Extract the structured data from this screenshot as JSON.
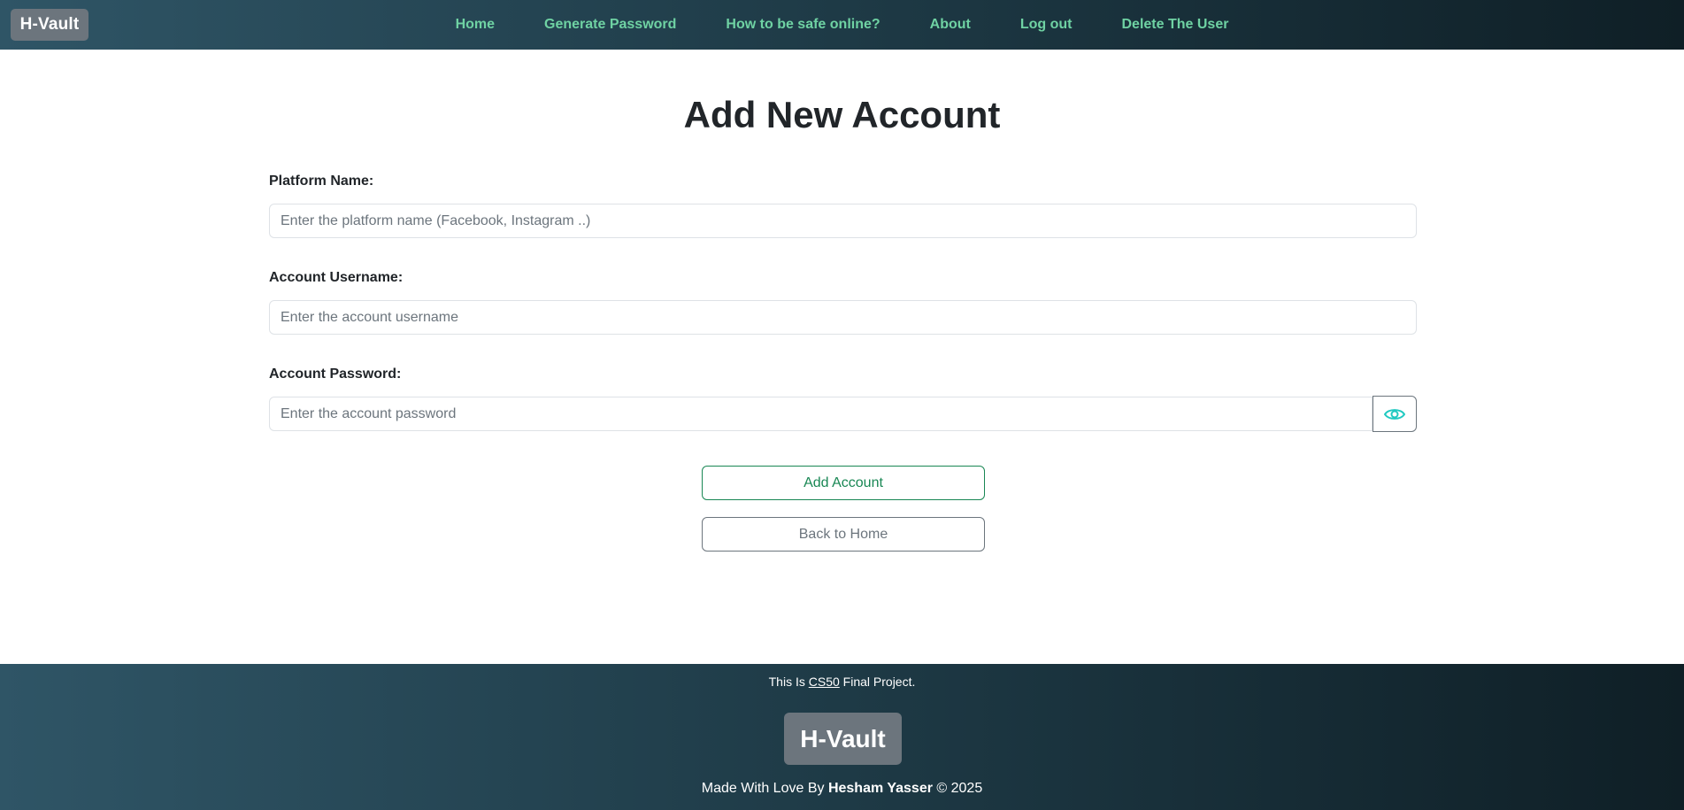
{
  "nav": {
    "brand": "H-Vault",
    "links": [
      "Home",
      "Generate Password",
      "How to be safe online?",
      "About",
      "Log out",
      "Delete The User"
    ]
  },
  "page": {
    "title": "Add New Account"
  },
  "form": {
    "platform": {
      "label": "Platform Name:",
      "placeholder": "Enter the platform name (Facebook, Instagram ..)"
    },
    "username": {
      "label": "Account Username:",
      "placeholder": "Enter the account username"
    },
    "password": {
      "label": "Account Password:",
      "placeholder": "Enter the account password"
    },
    "add_label": "Add Account",
    "back_label": "Back to Home"
  },
  "icons": {
    "toggle_password": "eye-icon"
  },
  "footer": {
    "note_prefix": "This Is ",
    "note_link": "CS50",
    "note_suffix": " Final Project.",
    "logo": "H-Vault",
    "credit_prefix": "Made With Love By ",
    "credit_name": "Hesham Yasser",
    "credit_suffix": " © 2025"
  },
  "colors": {
    "nav_link": "#6fd2a3",
    "brand_bg": "#6c757d",
    "add_button": "#198754",
    "eye_icon": "#20c9c1"
  }
}
